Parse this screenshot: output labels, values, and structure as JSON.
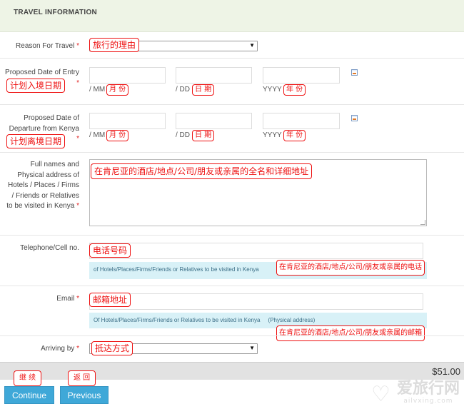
{
  "section": {
    "title": "TRAVEL INFORMATION"
  },
  "reason": {
    "label": "Reason For Travel",
    "required_mark": "*",
    "value": "",
    "annotation": "旅行的理由"
  },
  "entry_date": {
    "label_line1": "Proposed Date of Entry",
    "required_mark": "*",
    "mm_label": "/ MM",
    "dd_label": "/ DD",
    "yyyy_label": "YYYY",
    "annotation": "计划入境日期",
    "mm_annotation": "月 份",
    "dd_annotation": "日 期",
    "yyyy_annotation": "年 份",
    "calendar_icon": "calendar-icon"
  },
  "departure_date": {
    "label_line1": "Proposed Date of",
    "label_line2": "Departure from Kenya",
    "required_mark": "*",
    "mm_label": "/ MM",
    "dd_label": "/ DD",
    "yyyy_label": "YYYY",
    "annotation": "计划离境日期",
    "mm_annotation": "月 份",
    "dd_annotation": "日 期",
    "yyyy_annotation": "年 份",
    "calendar_icon": "calendar-icon"
  },
  "address": {
    "label_lines": [
      "Full names and",
      "Physical address of",
      "Hotels / Places / Firms",
      "/ Friends or Relatives",
      "to be visited in Kenya"
    ],
    "required_mark": "*",
    "value": "",
    "annotation": "在肯尼亚的酒店/地点/公司/朋友或亲属的全名和详细地址"
  },
  "telephone": {
    "label": "Telephone/Cell no.",
    "value": "",
    "annotation": "电话号码",
    "hint": "of Hotels/Places/Firms/Friends or Relatives to be visited in Kenya",
    "hint_annotation": "在肯尼亚的酒店/地点/公司/朋友或亲属的电话"
  },
  "email": {
    "label": "Email",
    "required_mark": "*",
    "value": "",
    "annotation": "邮箱地址",
    "hint": "Of Hotels/Places/Firms/Friends or Relatives to be visited in Kenya",
    "hint_extra": "(Physical address)",
    "hint_annotation": "在肯尼亚的酒店/地点/公司/朋友或亲属的邮箱"
  },
  "arriving_by": {
    "label": "Arriving by",
    "required_mark": "*",
    "value": "",
    "annotation": "抵达方式"
  },
  "footer": {
    "price": "$51.00",
    "continue_label": "Continue",
    "continue_annotation": "继 续",
    "previous_label": "Previous",
    "previous_annotation": "返 回"
  },
  "watermark": {
    "logo_text": "爱旅行网",
    "url_text": "ailvxing.com"
  },
  "colors": {
    "header_bg": "#eef4e6",
    "annotation": "#ee1111",
    "button": "#3fa8d8",
    "hint_bg": "#d8f1f7"
  }
}
